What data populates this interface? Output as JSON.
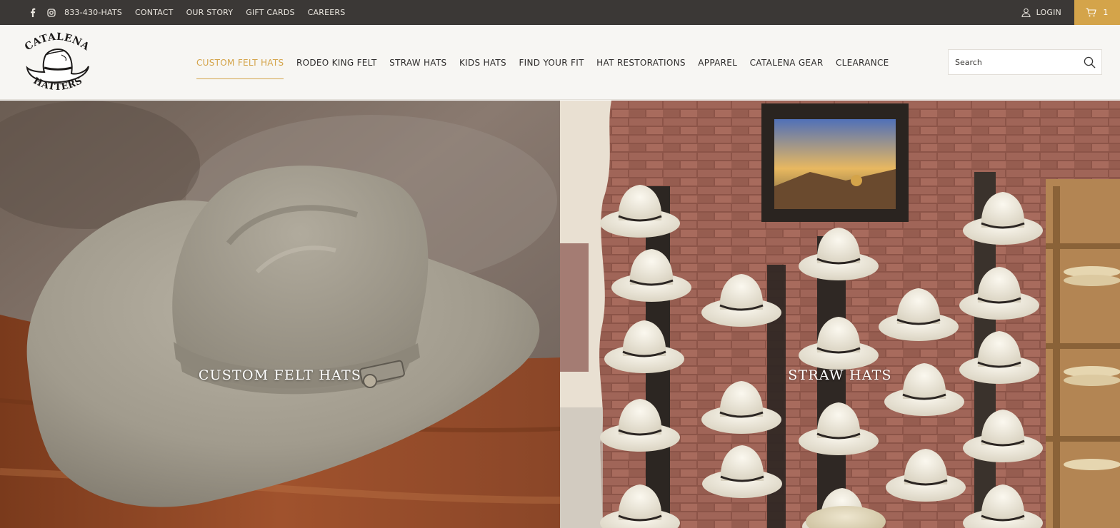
{
  "topbar": {
    "icons": [
      "facebook-icon",
      "instagram-icon"
    ],
    "links": [
      "833-430-HATS",
      "CONTACT",
      "OUR STORY",
      "GIFT CARDS",
      "CAREERS"
    ],
    "login_label": "LOGIN",
    "cart_count": "1"
  },
  "header": {
    "logo": {
      "line1": "CATALENA",
      "line2": "HATTERS"
    },
    "nav": [
      "CUSTOM FELT HATS",
      "RODEO KING FELT",
      "STRAW HATS",
      "KIDS HATS",
      "FIND YOUR FIT",
      "HAT RESTORATIONS",
      "APPAREL",
      "CATALENA GEAR",
      "CLEARANCE"
    ],
    "active_nav": "CUSTOM FELT HATS",
    "search_placeholder": "Search"
  },
  "hero": {
    "left_caption": "CUSTOM FELT HATS",
    "right_caption": "STRAW HATS"
  },
  "colors": {
    "topbar_bg": "#3b3836",
    "accent": "#d4a44a",
    "header_bg": "#f7f6f3"
  }
}
